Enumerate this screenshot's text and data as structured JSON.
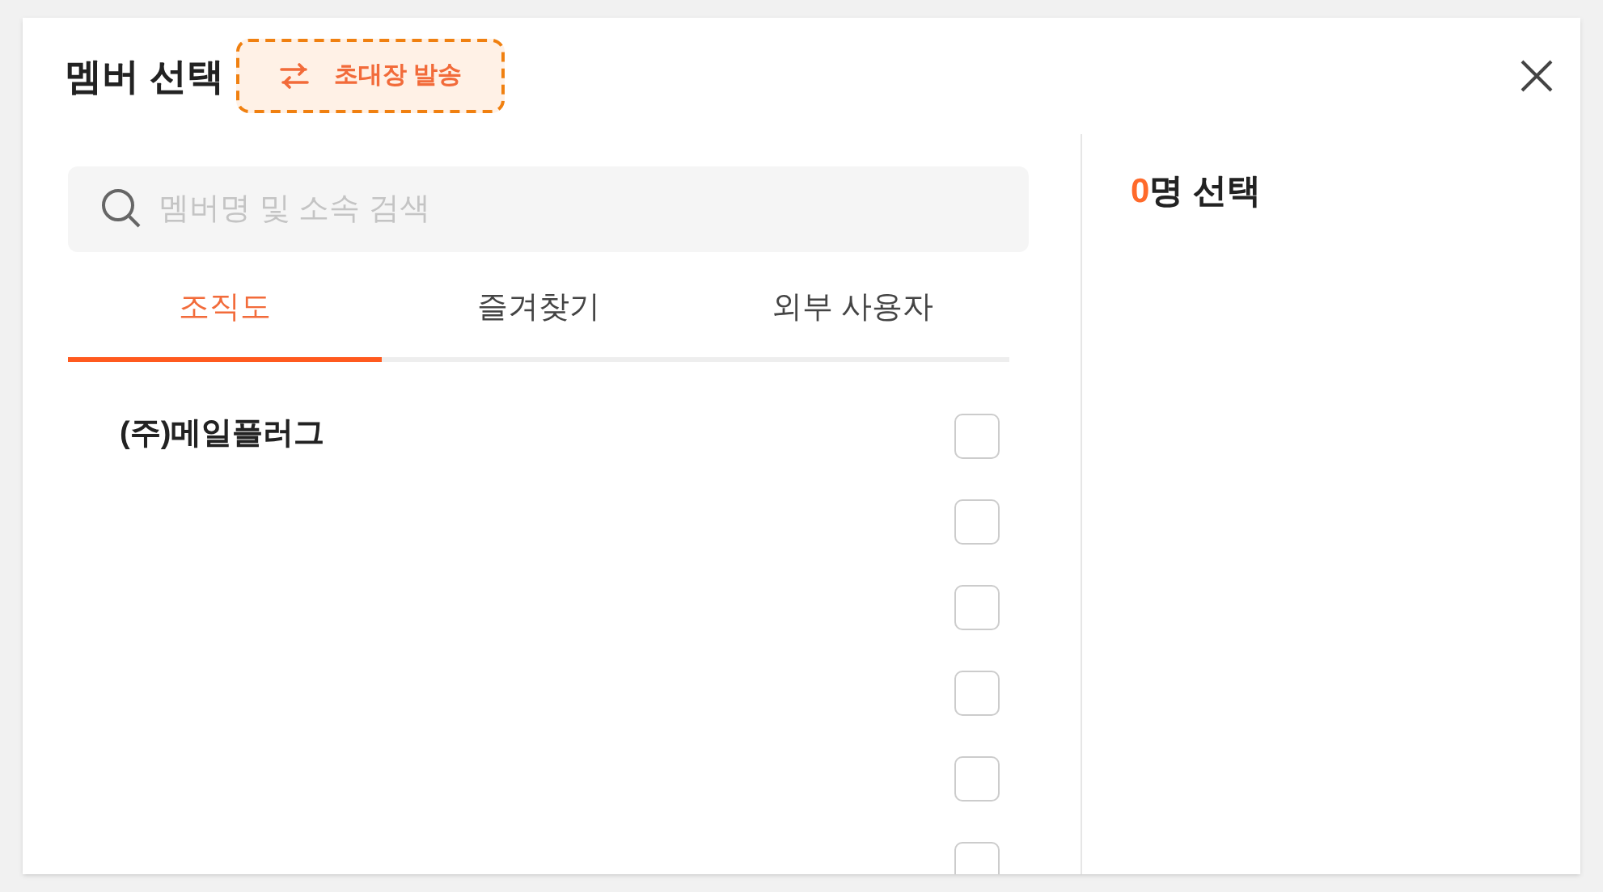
{
  "dialog": {
    "title": "멤버 선택",
    "invite_button": {
      "label": "초대장 발송",
      "highlighted": true
    }
  },
  "search": {
    "placeholder": "멤버명 및 소속 검색"
  },
  "tabs": [
    {
      "label": "조직도",
      "selected": true
    },
    {
      "label": "즐겨찾기",
      "selected": false
    },
    {
      "label": "외부 사용자",
      "selected": false
    }
  ],
  "rows": [
    {
      "label": "(주)메일플러그",
      "checked": false
    },
    {
      "checked": false
    },
    {
      "checked": false
    },
    {
      "checked": false
    },
    {
      "checked": false
    },
    {
      "checked": false
    }
  ],
  "selection": {
    "count": "0",
    "label": "명 선택"
  }
}
